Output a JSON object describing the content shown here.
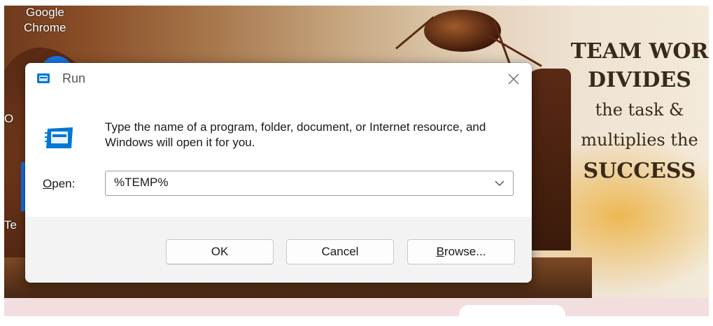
{
  "desktop": {
    "chrome_label_line1": "Google",
    "chrome_label_line2": "Chrome",
    "partial_label_1": "O",
    "partial_label_2": "Te"
  },
  "wallpaper_quote": {
    "line1": "TEAM WOR",
    "line2": "DIVIDES",
    "line3": "the task &",
    "line4": "multiplies the",
    "line5": "SUCCESS"
  },
  "run_dialog": {
    "title": "Run",
    "close_icon": "close-icon",
    "description": "Type the name of a program, folder, document, or Internet resource, and Windows will open it for you.",
    "open_label_mnemonic": "O",
    "open_label_rest": "pen:",
    "open_value": "%TEMP%",
    "buttons": {
      "ok": "OK",
      "cancel": "Cancel",
      "browse_mnemonic": "B",
      "browse_rest": "rowse..."
    }
  },
  "colors": {
    "accent": "#1a73e8",
    "run_icon_blue": "#0078d4",
    "footer_bg": "#f3f3f3"
  }
}
